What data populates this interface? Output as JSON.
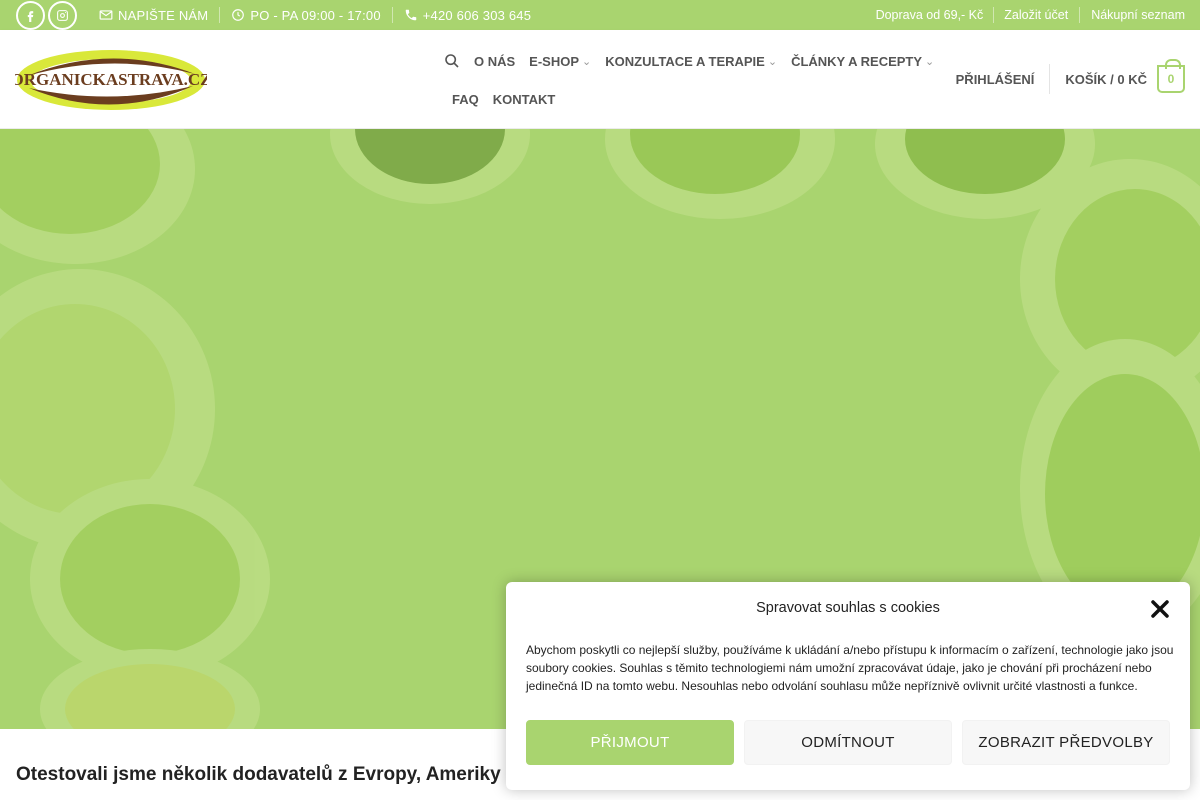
{
  "topbar": {
    "social": [
      {
        "name": "facebook-icon"
      },
      {
        "name": "instagram-icon"
      }
    ],
    "email_label": "NAPIŠTE NÁM",
    "hours_label": "PO - PA 09:00 - 17:00",
    "phone_label": "+420 606 303 645",
    "shipping_label": "Doprava od 69,- Kč",
    "create_account_label": "Založit účet",
    "shopping_list_label": "Nákupní seznam"
  },
  "header": {
    "logo_text": "ORGANICKASTRAVA.CZ",
    "nav": {
      "about": "O NÁS",
      "eshop": "E-SHOP",
      "consult": "KONZULTACE A TERAPIE",
      "articles": "ČLÁNKY A RECEPTY",
      "faq": "FAQ",
      "contact": "KONTAKT"
    },
    "login_label": "PŘIHLÁŠENÍ",
    "cart_label": "KOŠÍK / 0 KČ",
    "cart_count": "0"
  },
  "content": {
    "heading": "Otestovali jsme několik dodavatelů z Evropy, Ameriky"
  },
  "cookie": {
    "title": "Spravovat souhlas s cookies",
    "text": "Abychom poskytli co nejlepší služby, používáme k ukládání a/nebo přístupu k informacím o zařízení, technologie jako jsou soubory cookies. Souhlas s těmito technologiemi nám umožní zpracovávat údaje, jako je chování při procházení nebo jedinečná ID na tomto webu. Nesouhlas nebo odvolání souhlasu může nepříznivě ovlivnit určité vlastnosti a funkce.",
    "accept_label": "Přijmout",
    "deny_label": "Odmítnout",
    "prefs_label": "Zobrazit předvolby"
  },
  "colors": {
    "brand_green": "#a9d46f"
  }
}
